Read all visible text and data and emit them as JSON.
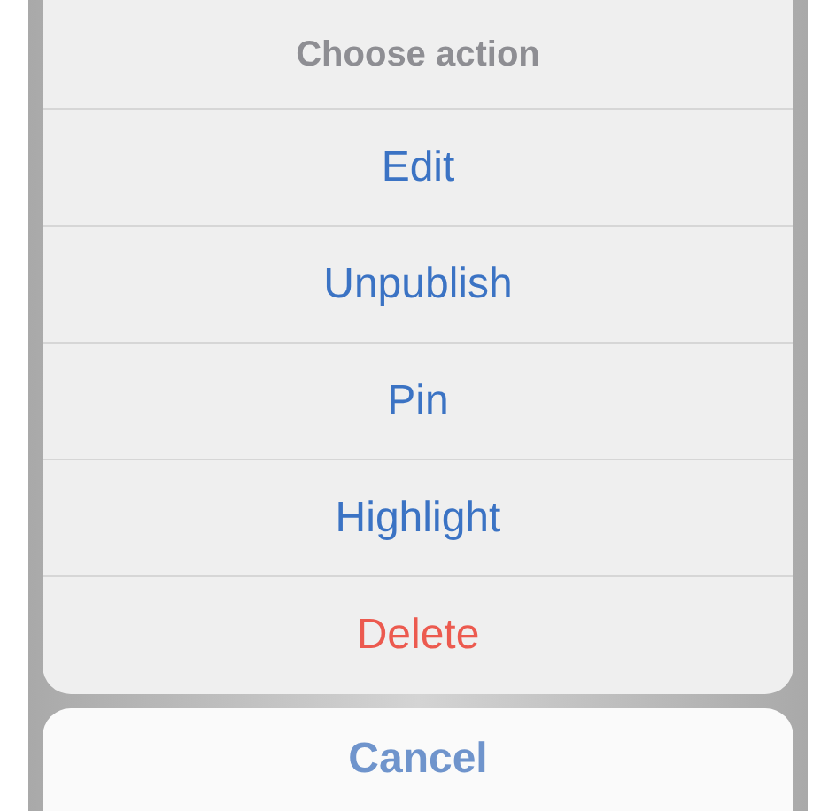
{
  "action_sheet": {
    "title": "Choose action",
    "actions": [
      {
        "label": "Edit",
        "kind": "default"
      },
      {
        "label": "Unpublish",
        "kind": "default"
      },
      {
        "label": "Pin",
        "kind": "default"
      },
      {
        "label": "Highlight",
        "kind": "default"
      },
      {
        "label": "Delete",
        "kind": "destructive"
      }
    ],
    "cancel": "Cancel"
  }
}
